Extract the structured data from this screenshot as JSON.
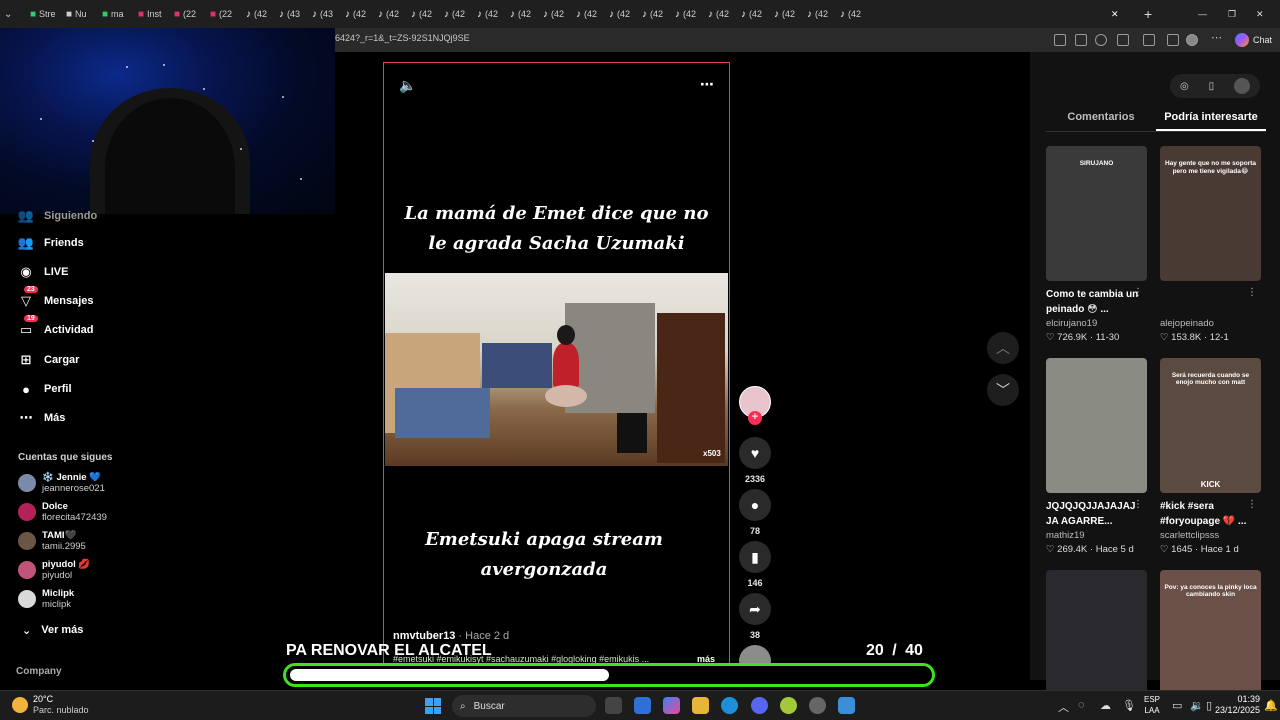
{
  "browser": {
    "tabs": [
      "Stre",
      "Nu",
      "ma",
      "Inst",
      "(22",
      "(22",
      "(42",
      "(43",
      "(43",
      "(42",
      "(42",
      "(42",
      "(42",
      "(42",
      "(42",
      "(42",
      "(42",
      "(42",
      "(42",
      "(42",
      "(42",
      "(42",
      "(42",
      "(42",
      "(42"
    ],
    "url": "6424?_r=1&_t=ZS-92S1NJQj9SE",
    "chat_label": "Chat"
  },
  "nav": {
    "items": [
      {
        "label": "Siguiendo",
        "icon": "following-icon"
      },
      {
        "label": "Friends",
        "icon": "friends-icon"
      },
      {
        "label": "LIVE",
        "icon": "live-icon"
      },
      {
        "label": "Mensajes",
        "icon": "messages-icon",
        "badge": "23"
      },
      {
        "label": "Actividad",
        "icon": "activity-icon",
        "badge": "19"
      },
      {
        "label": "Cargar",
        "icon": "upload-icon"
      },
      {
        "label": "Perfil",
        "icon": "profile-icon"
      },
      {
        "label": "Más",
        "icon": "more-icon"
      }
    ],
    "following_title": "Cuentas que sigues",
    "following": [
      {
        "name": "❄️ Jennie 💙",
        "handle": "jeannerose021",
        "color": "#7a8aa8"
      },
      {
        "name": "Dolce",
        "handle": "florecita472439",
        "color": "#b3205a"
      },
      {
        "name": "TAMI🖤",
        "handle": "tamii.2995",
        "color": "#6b5545"
      },
      {
        "name": "piyudol 💋",
        "handle": "piyudol",
        "color": "#c0547a"
      },
      {
        "name": "Miclipk",
        "handle": "miclipk",
        "color": "#d9d9d9"
      }
    ],
    "see_more": "Ver más",
    "company": "Company"
  },
  "video": {
    "caption_top": "La mamá de Emet dice que no le agrada Sacha Uzumaki",
    "caption_bottom": "Emetsuki apaga stream avergonzada",
    "author": "nmvtuber13",
    "time": " · Hace 2 d",
    "hashtags": "#emetsuki #emikukisyt #sachauzumaki #glogloking #emikukis ...",
    "more": "más",
    "watermark": "x503"
  },
  "actions": {
    "likes": "2336",
    "comments": "78",
    "saves": "146",
    "shares": "38"
  },
  "panel": {
    "tab_comments": "Comentarios",
    "tab_suggested": "Podría interesarte",
    "cards": [
      {
        "title": "Como te cambia un peinado 😳 ...",
        "user": "elcirujano19",
        "stats": "♡ 726.9K · 11-30",
        "bg": "#3a3a3a",
        "thumb_text": "SIRUJANO"
      },
      {
        "title": "",
        "user": "alejopeinado",
        "stats": "♡ 153.8K · 12-1",
        "bg": "#4a3a34",
        "thumb_text": "Hay gente que no me soporta pero me tiene vigilada😂"
      },
      {
        "title": "JQJQJQJJAJAJAJ JA AGARRE...",
        "user": "mathiz19",
        "stats": "♡ 269.4K · Hace 5 d",
        "bg": "#8a8c84",
        "thumb_text": ""
      },
      {
        "title": "#kick #sera #foryoupage 💔 ...",
        "user": "scarlettclipsss",
        "stats": "♡ 1645 · Hace 1 d",
        "bg": "#5b4a40",
        "thumb_text": "Será recuerda cuando se enojo mucho con matt",
        "thumb_text2": "KICK"
      },
      {
        "title": "",
        "user": "",
        "stats": "",
        "bg": "#2a2a2e",
        "thumb_text": ""
      },
      {
        "title": "",
        "user": "",
        "stats": "",
        "bg": "#6b5048",
        "thumb_text": "Pov: ya conoces la pinky loca cambiando skin"
      }
    ]
  },
  "overlay": {
    "text": "PA RENOVAR EL ALCATEL",
    "current": "20",
    "total": "/ 40",
    "progress": 0.5,
    "bar_color": "#3ee31b"
  },
  "taskbar": {
    "temp": "20°C",
    "weather": "Parc. nublado",
    "search": "Buscar",
    "lang1": "ESP",
    "lang2": "LAA",
    "time": "01:39",
    "date": "23/12/2025"
  }
}
